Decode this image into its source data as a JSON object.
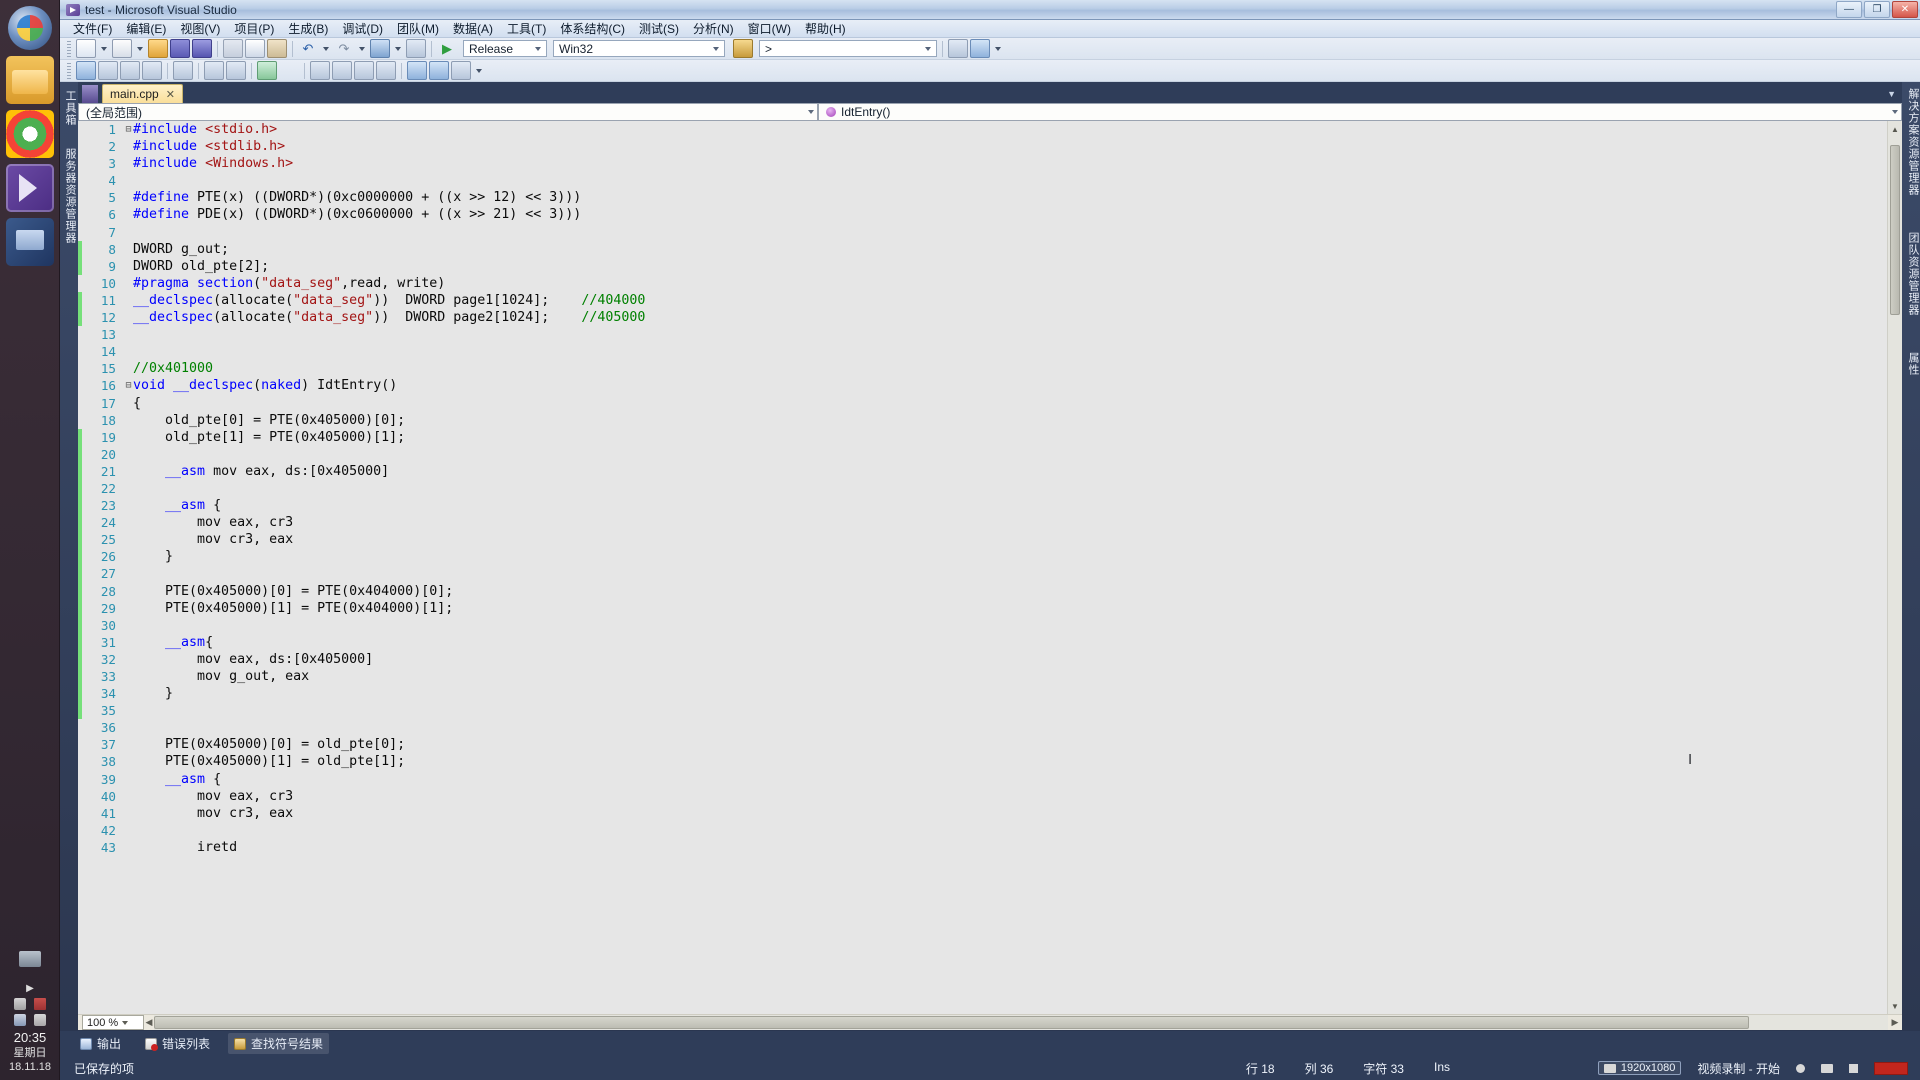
{
  "window": {
    "title": "test - Microsoft Visual Studio",
    "minimize": "—",
    "maximize": "❐",
    "close": "✕"
  },
  "menubar": {
    "items": [
      {
        "label": "文件(F)"
      },
      {
        "label": "编辑(E)"
      },
      {
        "label": "视图(V)"
      },
      {
        "label": "项目(P)"
      },
      {
        "label": "生成(B)"
      },
      {
        "label": "调试(D)"
      },
      {
        "label": "团队(M)"
      },
      {
        "label": "数据(A)"
      },
      {
        "label": "工具(T)"
      },
      {
        "label": "体系结构(C)"
      },
      {
        "label": "测试(S)"
      },
      {
        "label": "分析(N)"
      },
      {
        "label": "窗口(W)"
      },
      {
        "label": "帮助(H)"
      }
    ]
  },
  "toolbar": {
    "configuration": "Release",
    "platform": "Win32",
    "find_box_value": ">",
    "undo_glyph": "↶",
    "redo_glyph": "↷",
    "run_glyph": "▶"
  },
  "editor": {
    "left_strip_labels": [
      "工具箱",
      "服务器资源管理器"
    ],
    "right_strip_labels": [
      "解决方案资源管理器",
      "团队资源管理器",
      "属性"
    ],
    "tab": {
      "label": "main.cpp",
      "close": "✕"
    },
    "scope_left": "(全局范围)",
    "scope_right": "IdtEntry()",
    "zoom": "100 %",
    "lines": [
      {
        "n": 1,
        "fold": "⊟",
        "changed": false,
        "tokens": [
          {
            "t": "#include ",
            "c": "pp"
          },
          {
            "t": "<stdio.h>",
            "c": "str"
          }
        ]
      },
      {
        "n": 2,
        "fold": "",
        "changed": false,
        "tokens": [
          {
            "t": "#include ",
            "c": "pp"
          },
          {
            "t": "<stdlib.h>",
            "c": "str"
          }
        ]
      },
      {
        "n": 3,
        "fold": "",
        "changed": false,
        "tokens": [
          {
            "t": "#include ",
            "c": "pp"
          },
          {
            "t": "<Windows.h>",
            "c": "str"
          }
        ]
      },
      {
        "n": 4,
        "fold": "",
        "changed": false,
        "tokens": []
      },
      {
        "n": 5,
        "fold": "",
        "changed": false,
        "tokens": [
          {
            "t": "#define ",
            "c": "pp"
          },
          {
            "t": "PTE(x) ((DWORD*)(0xc0000000 + ((x >> 12) << 3)))",
            "c": ""
          }
        ]
      },
      {
        "n": 6,
        "fold": "",
        "changed": false,
        "tokens": [
          {
            "t": "#define ",
            "c": "pp"
          },
          {
            "t": "PDE(x) ((DWORD*)(0xc0600000 + ((x >> 21) << 3)))",
            "c": ""
          }
        ]
      },
      {
        "n": 7,
        "fold": "",
        "changed": false,
        "tokens": []
      },
      {
        "n": 8,
        "fold": "",
        "changed": true,
        "tokens": [
          {
            "t": "DWORD g_out;",
            "c": ""
          }
        ]
      },
      {
        "n": 9,
        "fold": "",
        "changed": true,
        "tokens": [
          {
            "t": "DWORD old_pte[2];",
            "c": ""
          }
        ]
      },
      {
        "n": 10,
        "fold": "",
        "changed": false,
        "tokens": [
          {
            "t": "#pragma section",
            "c": "pp"
          },
          {
            "t": "(",
            "c": ""
          },
          {
            "t": "\"data_seg\"",
            "c": "str"
          },
          {
            "t": ",read, write)",
            "c": ""
          }
        ]
      },
      {
        "n": 11,
        "fold": "",
        "changed": true,
        "tokens": [
          {
            "t": "__declspec",
            "c": "k"
          },
          {
            "t": "(allocate(",
            "c": ""
          },
          {
            "t": "\"data_seg\"",
            "c": "str"
          },
          {
            "t": "))  DWORD page1[1024];    ",
            "c": ""
          },
          {
            "t": "//404000",
            "c": "cm"
          }
        ]
      },
      {
        "n": 12,
        "fold": "",
        "changed": true,
        "tokens": [
          {
            "t": "__declspec",
            "c": "k"
          },
          {
            "t": "(allocate(",
            "c": ""
          },
          {
            "t": "\"data_seg\"",
            "c": "str"
          },
          {
            "t": "))  DWORD page2[1024];    ",
            "c": ""
          },
          {
            "t": "//405000",
            "c": "cm"
          }
        ]
      },
      {
        "n": 13,
        "fold": "",
        "changed": false,
        "tokens": []
      },
      {
        "n": 14,
        "fold": "",
        "changed": false,
        "tokens": []
      },
      {
        "n": 15,
        "fold": "",
        "changed": false,
        "tokens": [
          {
            "t": "//0x401000",
            "c": "cm"
          }
        ]
      },
      {
        "n": 16,
        "fold": "⊟",
        "changed": false,
        "tokens": [
          {
            "t": "void",
            "c": "k"
          },
          {
            "t": " ",
            "c": ""
          },
          {
            "t": "__declspec",
            "c": "k"
          },
          {
            "t": "(",
            "c": ""
          },
          {
            "t": "naked",
            "c": "k"
          },
          {
            "t": ") IdtEntry()",
            "c": ""
          }
        ]
      },
      {
        "n": 17,
        "fold": "",
        "changed": false,
        "tokens": [
          {
            "t": "{",
            "c": ""
          }
        ]
      },
      {
        "n": 18,
        "fold": "",
        "changed": false,
        "tokens": [
          {
            "t": "    old_pte[0] = PTE(0x405000)[0];",
            "c": ""
          }
        ]
      },
      {
        "n": 19,
        "fold": "",
        "changed": true,
        "tokens": [
          {
            "t": "    old_pte[1] = PTE(0x405000)[1];",
            "c": ""
          }
        ]
      },
      {
        "n": 20,
        "fold": "",
        "changed": true,
        "tokens": []
      },
      {
        "n": 21,
        "fold": "",
        "changed": true,
        "tokens": [
          {
            "t": "    ",
            "c": ""
          },
          {
            "t": "__asm",
            "c": "k"
          },
          {
            "t": " mov eax, ds:[0x405000]",
            "c": ""
          }
        ]
      },
      {
        "n": 22,
        "fold": "",
        "changed": true,
        "tokens": []
      },
      {
        "n": 23,
        "fold": "",
        "changed": true,
        "tokens": [
          {
            "t": "    ",
            "c": ""
          },
          {
            "t": "__asm",
            "c": "k"
          },
          {
            "t": " {",
            "c": ""
          }
        ]
      },
      {
        "n": 24,
        "fold": "",
        "changed": true,
        "tokens": [
          {
            "t": "        mov eax, cr3",
            "c": ""
          }
        ]
      },
      {
        "n": 25,
        "fold": "",
        "changed": true,
        "tokens": [
          {
            "t": "        mov cr3, eax",
            "c": ""
          }
        ]
      },
      {
        "n": 26,
        "fold": "",
        "changed": true,
        "tokens": [
          {
            "t": "    }",
            "c": ""
          }
        ]
      },
      {
        "n": 27,
        "fold": "",
        "changed": true,
        "tokens": []
      },
      {
        "n": 28,
        "fold": "",
        "changed": true,
        "tokens": [
          {
            "t": "    PTE(0x405000)[0] = PTE(0x404000)[0];",
            "c": ""
          }
        ]
      },
      {
        "n": 29,
        "fold": "",
        "changed": true,
        "tokens": [
          {
            "t": "    PTE(0x405000)[1] = PTE(0x404000)[1];",
            "c": ""
          }
        ]
      },
      {
        "n": 30,
        "fold": "",
        "changed": true,
        "tokens": []
      },
      {
        "n": 31,
        "fold": "",
        "changed": true,
        "tokens": [
          {
            "t": "    ",
            "c": ""
          },
          {
            "t": "__asm",
            "c": "k"
          },
          {
            "t": "{",
            "c": ""
          }
        ]
      },
      {
        "n": 32,
        "fold": "",
        "changed": true,
        "tokens": [
          {
            "t": "        mov eax, ds:[0x405000]",
            "c": ""
          }
        ]
      },
      {
        "n": 33,
        "fold": "",
        "changed": true,
        "tokens": [
          {
            "t": "        mov g_out, eax",
            "c": ""
          }
        ]
      },
      {
        "n": 34,
        "fold": "",
        "changed": true,
        "tokens": [
          {
            "t": "    }",
            "c": ""
          }
        ]
      },
      {
        "n": 35,
        "fold": "",
        "changed": true,
        "tokens": []
      },
      {
        "n": 36,
        "fold": "",
        "changed": false,
        "tokens": []
      },
      {
        "n": 37,
        "fold": "",
        "changed": false,
        "tokens": [
          {
            "t": "    PTE(0x405000)[0] = old_pte[0];",
            "c": ""
          }
        ]
      },
      {
        "n": 38,
        "fold": "",
        "changed": false,
        "tokens": [
          {
            "t": "    PTE(0x405000)[1] = old_pte[1];",
            "c": ""
          }
        ]
      },
      {
        "n": 39,
        "fold": "",
        "changed": false,
        "tokens": [
          {
            "t": "    ",
            "c": ""
          },
          {
            "t": "__asm",
            "c": "k"
          },
          {
            "t": " {",
            "c": ""
          }
        ]
      },
      {
        "n": 40,
        "fold": "",
        "changed": false,
        "tokens": [
          {
            "t": "        mov eax, cr3",
            "c": ""
          }
        ]
      },
      {
        "n": 41,
        "fold": "",
        "changed": false,
        "tokens": [
          {
            "t": "        mov cr3, eax",
            "c": ""
          }
        ]
      },
      {
        "n": 42,
        "fold": "",
        "changed": false,
        "tokens": []
      },
      {
        "n": 43,
        "fold": "",
        "changed": false,
        "tokens": [
          {
            "t": "        iretd",
            "c": ""
          }
        ]
      }
    ]
  },
  "bottom_panel": {
    "tabs": [
      {
        "label": "输出",
        "icon": "output-icon",
        "active": false
      },
      {
        "label": "错误列表",
        "icon": "error-list-icon",
        "active": false
      },
      {
        "label": "查找符号结果",
        "icon": "find-symbol-icon",
        "active": true
      }
    ]
  },
  "statusbar": {
    "saved_text": "已保存的项",
    "resolution_badge": "1920x1080",
    "recording_label": "视频录制 - 开始",
    "line": "行 18",
    "column": "列 36",
    "character": "字符 33",
    "insert_mode": "Ins"
  },
  "dock": {
    "time": "20:35",
    "weekday": "星期日",
    "date": "18.11.18",
    "items": [
      {
        "name": "ubuntu-logo"
      },
      {
        "name": "files-icon"
      },
      {
        "name": "chrome-icon"
      },
      {
        "name": "visual-studio-icon"
      },
      {
        "name": "vm-icon"
      }
    ]
  },
  "colors": {
    "vs_chrome": "#2f3d59",
    "editor_bg": "#e6e6e6",
    "keyword": "#0000ff",
    "string": "#a31515",
    "comment": "#008000",
    "linenum": "#2b91af",
    "tab_active": "#fadf9a",
    "change_marker": "#76e07a"
  }
}
